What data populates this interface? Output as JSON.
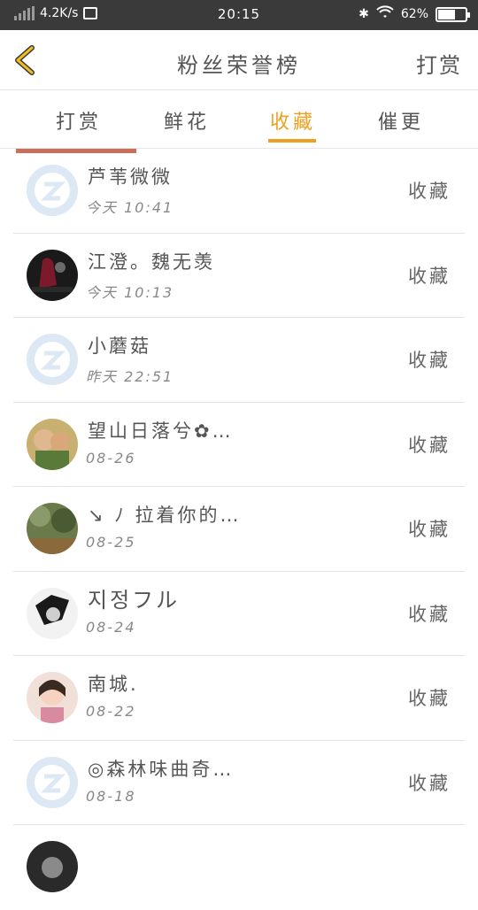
{
  "status_bar": {
    "speed": "4.2K/s",
    "time": "20:15",
    "battery": "62%"
  },
  "header": {
    "title": "粉丝荣誉榜",
    "action": "打赏"
  },
  "tabs": [
    {
      "label": "打赏",
      "active": false
    },
    {
      "label": "鲜花",
      "active": false
    },
    {
      "label": "收藏",
      "active": true
    },
    {
      "label": "催更",
      "active": false
    }
  ],
  "colors": {
    "accent": "#f0a020",
    "status_bar_bg": "#3a3a3a"
  },
  "fans": [
    {
      "name": "芦苇微微",
      "time": "今天 10:41",
      "action": "收藏",
      "avatar": "qq-default"
    },
    {
      "name": "江澄。魏无羡",
      "time": "今天 10:13",
      "action": "收藏",
      "avatar": "photo-dark"
    },
    {
      "name": "小蘑菇",
      "time": "昨天 22:51",
      "action": "收藏",
      "avatar": "qq-default"
    },
    {
      "name": "望山日落兮✿…",
      "time": "08-26",
      "action": "收藏",
      "avatar": "photo-cartoon"
    },
    {
      "name": "↘ ﾉ 拉着你的…",
      "time": "08-25",
      "action": "收藏",
      "avatar": "photo-nature"
    },
    {
      "name": "지정フル",
      "time": "08-24",
      "action": "收藏",
      "avatar": "photo-bw"
    },
    {
      "name": "南城.",
      "time": "08-22",
      "action": "收藏",
      "avatar": "photo-child"
    },
    {
      "name": "◎森林味曲奇…",
      "time": "08-18",
      "action": "收藏",
      "avatar": "qq-default"
    }
  ]
}
